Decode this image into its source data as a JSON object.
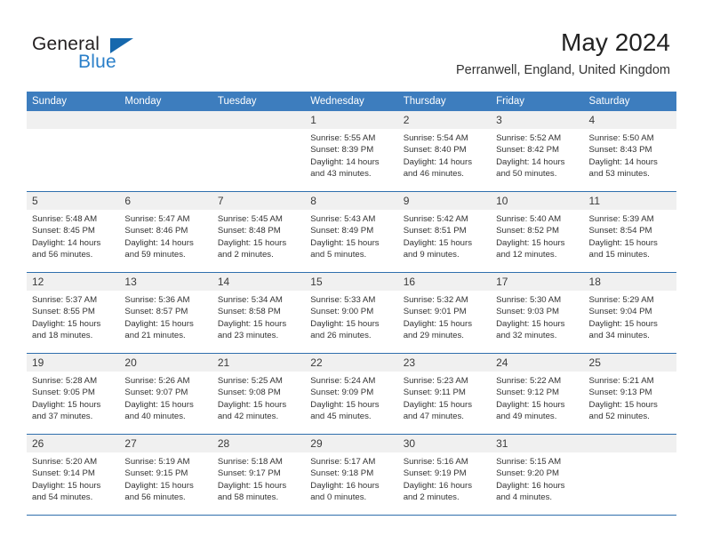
{
  "brand": {
    "name_part1": "General",
    "name_part2": "Blue",
    "accent_color": "#2a7fc9",
    "triangle_color": "#1668ad"
  },
  "header": {
    "month_title": "May 2024",
    "location": "Perranwell, England, United Kingdom"
  },
  "theme": {
    "header_blue": "#3d7dbe",
    "row_border_blue": "#2f6fad",
    "daynum_band": "#f0f0f0"
  },
  "weekday_headers": [
    "Sunday",
    "Monday",
    "Tuesday",
    "Wednesday",
    "Thursday",
    "Friday",
    "Saturday"
  ],
  "labels": {
    "sunrise_prefix": "Sunrise: ",
    "sunset_prefix": "Sunset: ",
    "daylight_prefix": "Daylight: "
  },
  "weeks": [
    [
      {
        "day": "",
        "empty": true
      },
      {
        "day": "",
        "empty": true
      },
      {
        "day": "",
        "empty": true
      },
      {
        "day": "1",
        "sunrise": "Sunrise: 5:55 AM",
        "sunset": "Sunset: 8:39 PM",
        "daylight": "Daylight: 14 hours and 43 minutes."
      },
      {
        "day": "2",
        "sunrise": "Sunrise: 5:54 AM",
        "sunset": "Sunset: 8:40 PM",
        "daylight": "Daylight: 14 hours and 46 minutes."
      },
      {
        "day": "3",
        "sunrise": "Sunrise: 5:52 AM",
        "sunset": "Sunset: 8:42 PM",
        "daylight": "Daylight: 14 hours and 50 minutes."
      },
      {
        "day": "4",
        "sunrise": "Sunrise: 5:50 AM",
        "sunset": "Sunset: 8:43 PM",
        "daylight": "Daylight: 14 hours and 53 minutes."
      }
    ],
    [
      {
        "day": "5",
        "sunrise": "Sunrise: 5:48 AM",
        "sunset": "Sunset: 8:45 PM",
        "daylight": "Daylight: 14 hours and 56 minutes."
      },
      {
        "day": "6",
        "sunrise": "Sunrise: 5:47 AM",
        "sunset": "Sunset: 8:46 PM",
        "daylight": "Daylight: 14 hours and 59 minutes."
      },
      {
        "day": "7",
        "sunrise": "Sunrise: 5:45 AM",
        "sunset": "Sunset: 8:48 PM",
        "daylight": "Daylight: 15 hours and 2 minutes."
      },
      {
        "day": "8",
        "sunrise": "Sunrise: 5:43 AM",
        "sunset": "Sunset: 8:49 PM",
        "daylight": "Daylight: 15 hours and 5 minutes."
      },
      {
        "day": "9",
        "sunrise": "Sunrise: 5:42 AM",
        "sunset": "Sunset: 8:51 PM",
        "daylight": "Daylight: 15 hours and 9 minutes."
      },
      {
        "day": "10",
        "sunrise": "Sunrise: 5:40 AM",
        "sunset": "Sunset: 8:52 PM",
        "daylight": "Daylight: 15 hours and 12 minutes."
      },
      {
        "day": "11",
        "sunrise": "Sunrise: 5:39 AM",
        "sunset": "Sunset: 8:54 PM",
        "daylight": "Daylight: 15 hours and 15 minutes."
      }
    ],
    [
      {
        "day": "12",
        "sunrise": "Sunrise: 5:37 AM",
        "sunset": "Sunset: 8:55 PM",
        "daylight": "Daylight: 15 hours and 18 minutes."
      },
      {
        "day": "13",
        "sunrise": "Sunrise: 5:36 AM",
        "sunset": "Sunset: 8:57 PM",
        "daylight": "Daylight: 15 hours and 21 minutes."
      },
      {
        "day": "14",
        "sunrise": "Sunrise: 5:34 AM",
        "sunset": "Sunset: 8:58 PM",
        "daylight": "Daylight: 15 hours and 23 minutes."
      },
      {
        "day": "15",
        "sunrise": "Sunrise: 5:33 AM",
        "sunset": "Sunset: 9:00 PM",
        "daylight": "Daylight: 15 hours and 26 minutes."
      },
      {
        "day": "16",
        "sunrise": "Sunrise: 5:32 AM",
        "sunset": "Sunset: 9:01 PM",
        "daylight": "Daylight: 15 hours and 29 minutes."
      },
      {
        "day": "17",
        "sunrise": "Sunrise: 5:30 AM",
        "sunset": "Sunset: 9:03 PM",
        "daylight": "Daylight: 15 hours and 32 minutes."
      },
      {
        "day": "18",
        "sunrise": "Sunrise: 5:29 AM",
        "sunset": "Sunset: 9:04 PM",
        "daylight": "Daylight: 15 hours and 34 minutes."
      }
    ],
    [
      {
        "day": "19",
        "sunrise": "Sunrise: 5:28 AM",
        "sunset": "Sunset: 9:05 PM",
        "daylight": "Daylight: 15 hours and 37 minutes."
      },
      {
        "day": "20",
        "sunrise": "Sunrise: 5:26 AM",
        "sunset": "Sunset: 9:07 PM",
        "daylight": "Daylight: 15 hours and 40 minutes."
      },
      {
        "day": "21",
        "sunrise": "Sunrise: 5:25 AM",
        "sunset": "Sunset: 9:08 PM",
        "daylight": "Daylight: 15 hours and 42 minutes."
      },
      {
        "day": "22",
        "sunrise": "Sunrise: 5:24 AM",
        "sunset": "Sunset: 9:09 PM",
        "daylight": "Daylight: 15 hours and 45 minutes."
      },
      {
        "day": "23",
        "sunrise": "Sunrise: 5:23 AM",
        "sunset": "Sunset: 9:11 PM",
        "daylight": "Daylight: 15 hours and 47 minutes."
      },
      {
        "day": "24",
        "sunrise": "Sunrise: 5:22 AM",
        "sunset": "Sunset: 9:12 PM",
        "daylight": "Daylight: 15 hours and 49 minutes."
      },
      {
        "day": "25",
        "sunrise": "Sunrise: 5:21 AM",
        "sunset": "Sunset: 9:13 PM",
        "daylight": "Daylight: 15 hours and 52 minutes."
      }
    ],
    [
      {
        "day": "26",
        "sunrise": "Sunrise: 5:20 AM",
        "sunset": "Sunset: 9:14 PM",
        "daylight": "Daylight: 15 hours and 54 minutes."
      },
      {
        "day": "27",
        "sunrise": "Sunrise: 5:19 AM",
        "sunset": "Sunset: 9:15 PM",
        "daylight": "Daylight: 15 hours and 56 minutes."
      },
      {
        "day": "28",
        "sunrise": "Sunrise: 5:18 AM",
        "sunset": "Sunset: 9:17 PM",
        "daylight": "Daylight: 15 hours and 58 minutes."
      },
      {
        "day": "29",
        "sunrise": "Sunrise: 5:17 AM",
        "sunset": "Sunset: 9:18 PM",
        "daylight": "Daylight: 16 hours and 0 minutes."
      },
      {
        "day": "30",
        "sunrise": "Sunrise: 5:16 AM",
        "sunset": "Sunset: 9:19 PM",
        "daylight": "Daylight: 16 hours and 2 minutes."
      },
      {
        "day": "31",
        "sunrise": "Sunrise: 5:15 AM",
        "sunset": "Sunset: 9:20 PM",
        "daylight": "Daylight: 16 hours and 4 minutes."
      },
      {
        "day": "",
        "empty": true
      }
    ]
  ]
}
